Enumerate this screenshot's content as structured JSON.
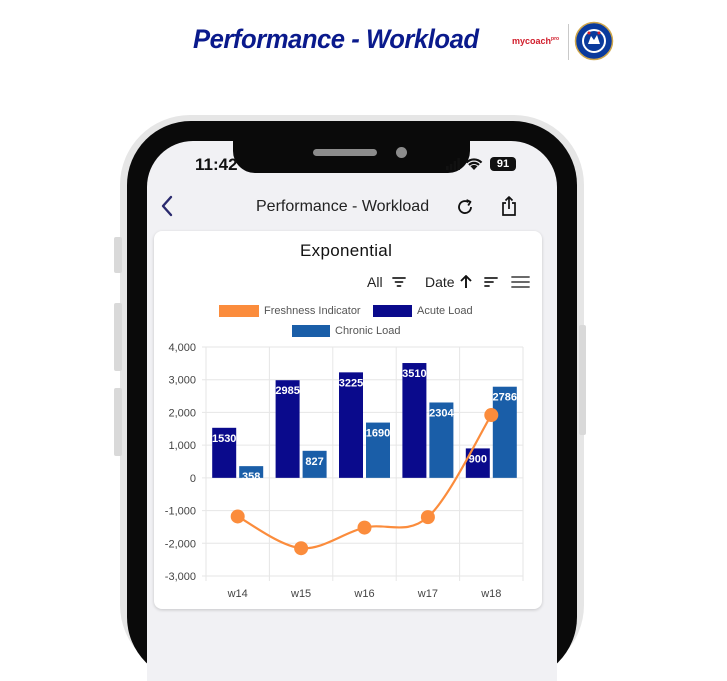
{
  "banner": {
    "title": "Performance - Workload",
    "brand": "mycoach",
    "brand_sup": "pro"
  },
  "status_bar": {
    "time": "11:42",
    "battery": "91"
  },
  "nav": {
    "title": "Performance - Workload"
  },
  "card": {
    "title": "Exponential",
    "filter_label": "All",
    "sort_label": "Date"
  },
  "colors": {
    "freshness": "#fb8c3c",
    "acute": "#0a0a8c",
    "chronic": "#1a5ea8",
    "banner": "#0a1a8c"
  },
  "icons": [
    "back-chevron-icon",
    "refresh-icon",
    "share-icon",
    "filter-icon",
    "arrow-up-icon",
    "sort-icon",
    "menu-icon",
    "wifi-icon",
    "signal-icon",
    "battery-icon"
  ],
  "chart_data": {
    "type": "bar",
    "title": "",
    "categories": [
      "w14",
      "w15",
      "w16",
      "w17",
      "w18"
    ],
    "series": [
      {
        "name": "Acute Load",
        "type": "bar",
        "values": [
          1530,
          2985,
          3225,
          3510,
          900
        ]
      },
      {
        "name": "Chronic Load",
        "type": "bar",
        "values": [
          358,
          827,
          1690,
          2304,
          2786
        ]
      },
      {
        "name": "Freshness Indicator",
        "type": "line",
        "values": [
          -1180,
          -2150,
          -1520,
          -1200,
          1920
        ]
      }
    ],
    "legend_order": [
      "Freshness Indicator",
      "Acute Load",
      "Chronic Load"
    ],
    "ylim": [
      -3000,
      4000
    ],
    "yticks": [
      "4,000",
      "3,000",
      "2,000",
      "1,000",
      "0",
      "-1,000",
      "-2,000",
      "-3,000"
    ],
    "yticks_values": [
      4000,
      3000,
      2000,
      1000,
      0,
      -1000,
      -2000,
      -3000
    ],
    "grid": true,
    "legend_position": "top"
  }
}
